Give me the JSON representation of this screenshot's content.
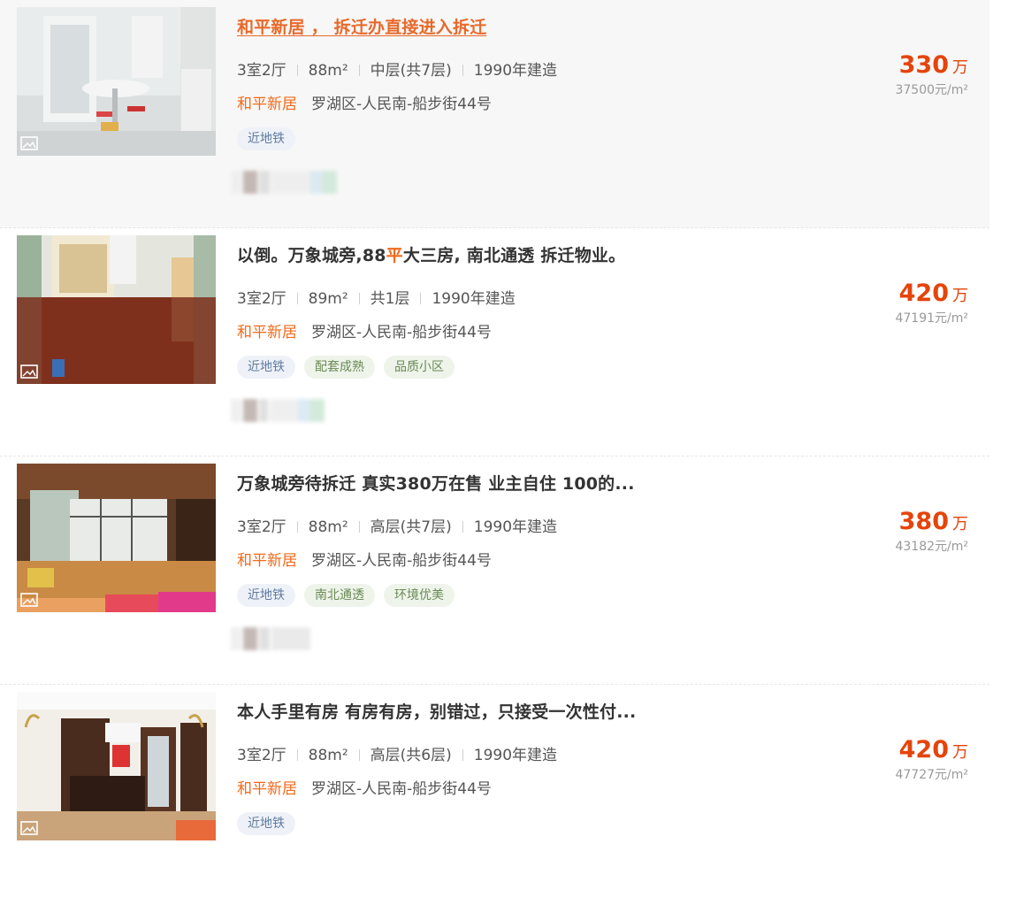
{
  "listings": [
    {
      "title": "和平新居 ， 拆迁办直接进入拆迁",
      "specs": [
        "3室2厅",
        "88m²",
        "中层(共7层)",
        "1990年建造"
      ],
      "community": "和平新居",
      "address": "罗湖区-人民南-船步街44号",
      "tags": [
        {
          "label": "近地铁",
          "color": "blue"
        }
      ],
      "price_total": "330",
      "price_unit": "万",
      "price_per": "37500元/m²"
    },
    {
      "title_parts": [
        "以倒。万象城旁,88",
        "平",
        "大三房, 南北通透 拆迁物业。"
      ],
      "specs": [
        "3室2厅",
        "89m²",
        "共1层",
        "1990年建造"
      ],
      "community": "和平新居",
      "address": "罗湖区-人民南-船步街44号",
      "tags": [
        {
          "label": "近地铁",
          "color": "blue"
        },
        {
          "label": "配套成熟",
          "color": "green"
        },
        {
          "label": "品质小区",
          "color": "green"
        }
      ],
      "price_total": "420",
      "price_unit": "万",
      "price_per": "47191元/m²"
    },
    {
      "title": "万象城旁待拆迁 真实380万在售 业主自住 100的...",
      "specs": [
        "3室2厅",
        "88m²",
        "高层(共7层)",
        "1990年建造"
      ],
      "community": "和平新居",
      "address": "罗湖区-人民南-船步街44号",
      "tags": [
        {
          "label": "近地铁",
          "color": "blue"
        },
        {
          "label": "南北通透",
          "color": "green"
        },
        {
          "label": "环境优美",
          "color": "green"
        }
      ],
      "price_total": "380",
      "price_unit": "万",
      "price_per": "43182元/m²"
    },
    {
      "title": "本人手里有房 有房有房，别错过，只接受一次性付...",
      "specs": [
        "3室2厅",
        "88m²",
        "高层(共6层)",
        "1990年建造"
      ],
      "community": "和平新居",
      "address": "罗湖区-人民南-船步街44号",
      "tags": [
        {
          "label": "近地铁",
          "color": "blue"
        }
      ],
      "price_total": "420",
      "price_unit": "万",
      "price_per": "47727元/m²"
    }
  ],
  "colors": {
    "accent": "#f26a1b",
    "price": "#e5440b"
  },
  "icons": {
    "photo": "photo-gallery-icon"
  }
}
